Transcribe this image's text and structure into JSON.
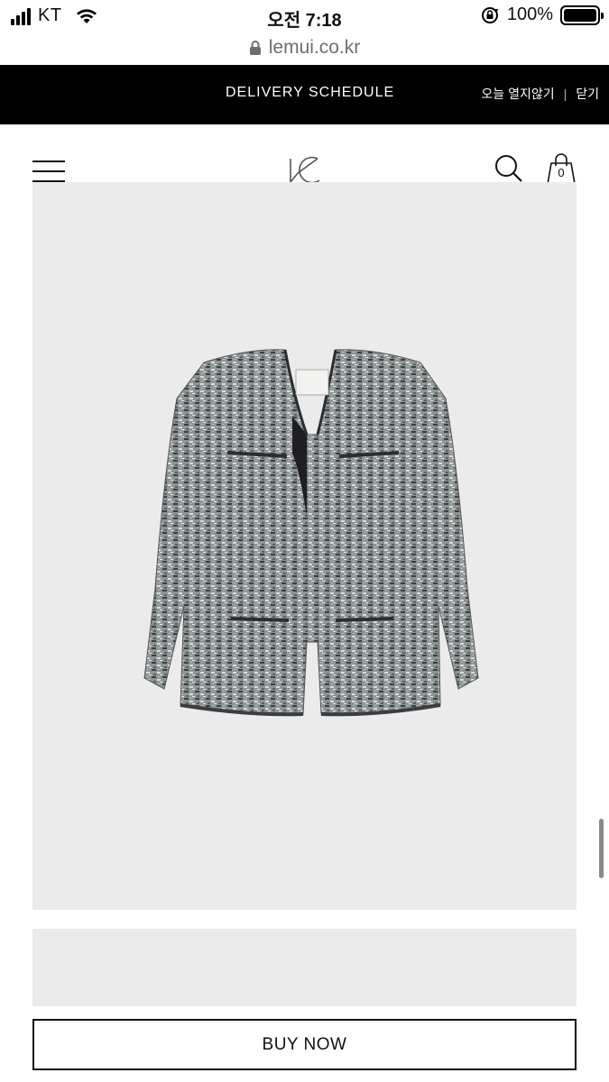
{
  "status_bar": {
    "carrier": "KT",
    "time": "오전 7:18",
    "battery_percent": "100%"
  },
  "browser": {
    "url": "lemui.co.kr"
  },
  "banner": {
    "title": "DELIVERY SCHEDULE",
    "dismiss_today": "오늘 열지않기",
    "separator": "|",
    "close": "닫기"
  },
  "header": {
    "cart_count": "0",
    "icons": [
      "hamburger-menu-icon",
      "logo",
      "search-icon",
      "shopping-bag-icon"
    ]
  },
  "product": {
    "image_subject": "tweed-jacket",
    "buy_label": "BUY NOW"
  },
  "colors": {
    "banner_bg": "#000000",
    "image_bg": "#ebebeb",
    "text": "#111111"
  }
}
